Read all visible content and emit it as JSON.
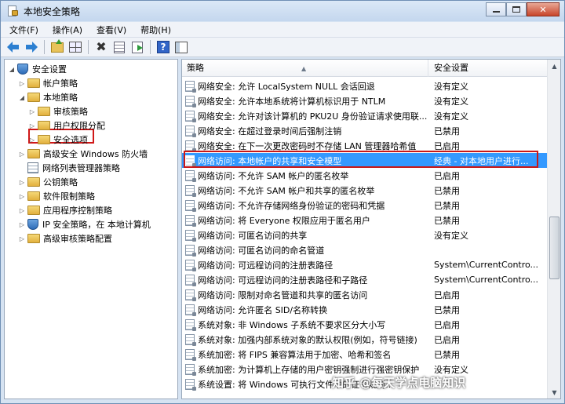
{
  "window": {
    "title": "本地安全策略"
  },
  "menu": [
    "文件(F)",
    "操作(A)",
    "查看(V)",
    "帮助(H)"
  ],
  "tree": [
    {
      "label": "安全设置",
      "indent": 0,
      "toggle": "◢",
      "icon": "shield-icon"
    },
    {
      "label": "帐户策略",
      "indent": 1,
      "toggle": "▷",
      "icon": "folder-icon"
    },
    {
      "label": "本地策略",
      "indent": 1,
      "toggle": "◢",
      "icon": "folder-icon"
    },
    {
      "label": "审核策略",
      "indent": 2,
      "toggle": "▷",
      "icon": "folder-icon"
    },
    {
      "label": "用户权限分配",
      "indent": 2,
      "toggle": "▷",
      "icon": "folder-icon"
    },
    {
      "label": "安全选项",
      "indent": 2,
      "toggle": "▷",
      "icon": "folder-icon"
    },
    {
      "label": "高级安全 Windows 防火墙",
      "indent": 1,
      "toggle": "▷",
      "icon": "folder-icon"
    },
    {
      "label": "网络列表管理器策略",
      "indent": 1,
      "toggle": "",
      "icon": "docs-icon"
    },
    {
      "label": "公钥策略",
      "indent": 1,
      "toggle": "▷",
      "icon": "folder-icon"
    },
    {
      "label": "软件限制策略",
      "indent": 1,
      "toggle": "▷",
      "icon": "folder-icon"
    },
    {
      "label": "应用程序控制策略",
      "indent": 1,
      "toggle": "▷",
      "icon": "folder-icon"
    },
    {
      "label": "IP 安全策略，在 本地计算机",
      "indent": 1,
      "toggle": "▷",
      "icon": "shield-icon"
    },
    {
      "label": "高级审核策略配置",
      "indent": 1,
      "toggle": "▷",
      "icon": "folder-icon"
    }
  ],
  "list": {
    "columns": {
      "policy": "策略",
      "setting": "安全设置"
    },
    "rows": [
      {
        "policy": "网络安全: 允许 LocalSystem NULL 会话回退",
        "setting": "没有定义"
      },
      {
        "policy": "网络安全: 允许本地系统将计算机标识用于 NTLM",
        "setting": "没有定义"
      },
      {
        "policy": "网络安全: 允许对该计算机的 PKU2U 身份验证请求使用联...",
        "setting": "没有定义"
      },
      {
        "policy": "网络安全: 在超过登录时间后强制注销",
        "setting": "已禁用"
      },
      {
        "policy": "网络安全: 在下一次更改密码时不存储 LAN 管理器哈希值",
        "setting": "已启用"
      },
      {
        "policy": "网络访问: 本地帐户的共享和安全模型",
        "setting": "经典 - 对本地用户进行..."
      },
      {
        "policy": "网络访问: 不允许 SAM 帐户的匿名枚举",
        "setting": "已启用"
      },
      {
        "policy": "网络访问: 不允许 SAM 帐户和共享的匿名枚举",
        "setting": "已禁用"
      },
      {
        "policy": "网络访问: 不允许存储网络身份验证的密码和凭据",
        "setting": "已禁用"
      },
      {
        "policy": "网络访问: 将 Everyone 权限应用于匿名用户",
        "setting": "已禁用"
      },
      {
        "policy": "网络访问: 可匿名访问的共享",
        "setting": "没有定义"
      },
      {
        "policy": "网络访问: 可匿名访问的命名管道",
        "setting": ""
      },
      {
        "policy": "网络访问: 可远程访问的注册表路径",
        "setting": "System\\CurrentContro..."
      },
      {
        "policy": "网络访问: 可远程访问的注册表路径和子路径",
        "setting": "System\\CurrentContro..."
      },
      {
        "policy": "网络访问: 限制对命名管道和共享的匿名访问",
        "setting": "已启用"
      },
      {
        "policy": "网络访问: 允许匿名 SID/名称转换",
        "setting": "已禁用"
      },
      {
        "policy": "系统对象: 非 Windows 子系统不要求区分大小写",
        "setting": "已启用"
      },
      {
        "policy": "系统对象: 加强内部系统对象的默认权限(例如，符号链接)",
        "setting": "已启用"
      },
      {
        "policy": "系统加密: 将 FIPS 兼容算法用于加密、哈希和签名",
        "setting": "已禁用"
      },
      {
        "policy": "系统加密: 为计算机上存储的用户密钥强制进行强密钥保护",
        "setting": "没有定义"
      },
      {
        "policy": "系统设置: 将 Windows 可执行文件中的证书规则...",
        "setting": ""
      }
    ],
    "selected_index": 5
  },
  "watermark": "知乎 @每天学点电脑知识"
}
